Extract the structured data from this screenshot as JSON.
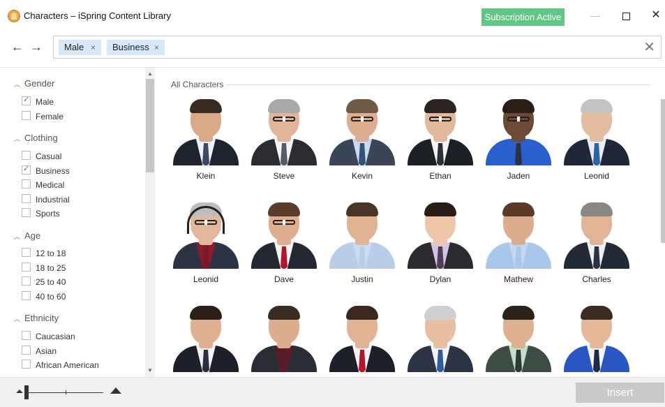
{
  "window": {
    "title": "Characters – iSpring Content Library",
    "subscription_badge": "Subscription Active",
    "minimize_glyph": "—",
    "close_glyph": "✕"
  },
  "nav": {
    "back_glyph": "←",
    "forward_glyph": "→",
    "tags": [
      {
        "label": "Male",
        "remove_glyph": "×"
      },
      {
        "label": "Business",
        "remove_glyph": "×"
      }
    ],
    "clear_glyph": "✕"
  },
  "filters": {
    "collapse_glyph": "︿",
    "gender": {
      "label": "Gender",
      "options": [
        {
          "label": "Male",
          "checked": true
        },
        {
          "label": "Female",
          "checked": false
        }
      ]
    },
    "clothing": {
      "label": "Clothing",
      "options": [
        {
          "label": "Casual",
          "checked": false
        },
        {
          "label": "Business",
          "checked": true
        },
        {
          "label": "Medical",
          "checked": false
        },
        {
          "label": "Industrial",
          "checked": false
        },
        {
          "label": "Sports",
          "checked": false
        }
      ]
    },
    "age": {
      "label": "Age",
      "options": [
        {
          "label": "12 to 18",
          "checked": false
        },
        {
          "label": "18 to 25",
          "checked": false
        },
        {
          "label": "25 to 40",
          "checked": false
        },
        {
          "label": "40 to 60",
          "checked": false
        }
      ]
    },
    "ethnicity": {
      "label": "Ethnicity",
      "options": [
        {
          "label": "Caucasian",
          "checked": false
        },
        {
          "label": "Asian",
          "checked": false
        },
        {
          "label": "African American",
          "checked": false
        }
      ]
    }
  },
  "main": {
    "section_label": "All Characters",
    "characters": [
      {
        "name": "Klein"
      },
      {
        "name": "Steve"
      },
      {
        "name": "Kevin"
      },
      {
        "name": "Ethan"
      },
      {
        "name": "Jaden"
      },
      {
        "name": "Leonid"
      },
      {
        "name": "Leonid"
      },
      {
        "name": "Dave"
      },
      {
        "name": "Justin"
      },
      {
        "name": "Dylan"
      },
      {
        "name": "Mathew"
      },
      {
        "name": "Charles"
      },
      {
        "name": ""
      },
      {
        "name": ""
      },
      {
        "name": ""
      },
      {
        "name": ""
      },
      {
        "name": ""
      },
      {
        "name": ""
      }
    ]
  },
  "footer": {
    "insert_label": "Insert"
  },
  "colors": {
    "subscription_green": "#62c584",
    "tag_blue": "#d6e9f8",
    "insert_disabled": "#c9c9c9"
  }
}
